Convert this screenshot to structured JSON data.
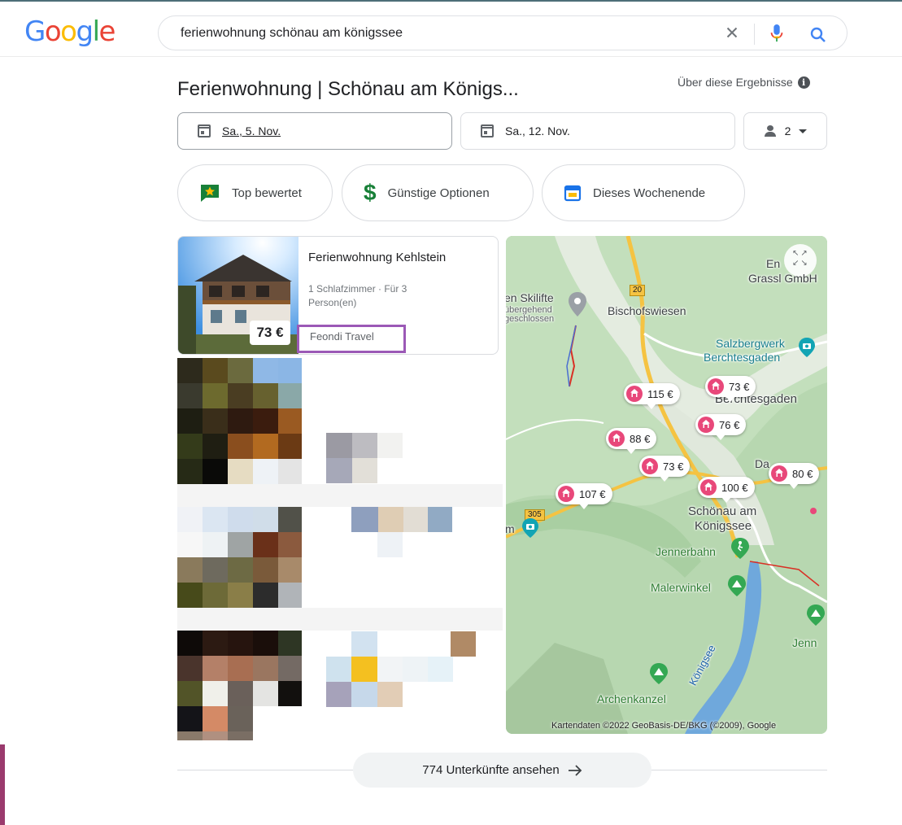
{
  "logo": {
    "text": "Google"
  },
  "search": {
    "query": "ferienwohnung schönau am königssee"
  },
  "header": {
    "title": "Ferienwohnung | Schönau am Königs...",
    "about": "Über diese Ergebnisse"
  },
  "dates": {
    "checkin": "Sa., 5. Nov.",
    "checkout": "Sa., 12. Nov.",
    "guests": "2"
  },
  "chips": [
    {
      "label": "Top bewertet",
      "icon": "star-flag-icon"
    },
    {
      "label": "Günstige Optionen",
      "icon": "dollar-icon"
    },
    {
      "label": "Dieses Wochenende",
      "icon": "calendar-icon"
    }
  ],
  "listing": {
    "title": "Ferienwohnung Kehlstein",
    "desc": "1 Schlafzimmer · Für 3 Person(en)",
    "price": "73 €",
    "provider": "Feondi Travel"
  },
  "map": {
    "labels": {
      "skilifte": "en Skilifte",
      "skilifte_sub1": "übergehend",
      "skilifte_sub2": "geschlossen",
      "bischofswiesen": "Bischofswiesen",
      "salzbergwerk1": "Salzbergwerk",
      "salzbergwerk2": "Berchtesgaden",
      "berchtesgaden": "Berchtesgaden",
      "enz1": "En",
      "enz2": "Grassl GmbH",
      "schoenau1": "Schönau am",
      "schoenau2": "Königssee",
      "jennerbahn": "Jennerbahn",
      "malerwinkel": "Malerwinkel",
      "jenner": "Jenn",
      "archenkanzel": "Archenkanzel",
      "koenigssee": "Königsee",
      "da": "Da",
      "m": "m"
    },
    "roads": {
      "r20": "20",
      "r305": "305"
    },
    "pins": [
      "115 €",
      "73 €",
      "76 €",
      "88 €",
      "73 €",
      "107 €",
      "100 €",
      "80 €"
    ],
    "credit": "Kartendaten ©2022 GeoBasis-DE/BKG (©2009), Google"
  },
  "more": {
    "label": "774 Unterkünfte ansehen"
  }
}
